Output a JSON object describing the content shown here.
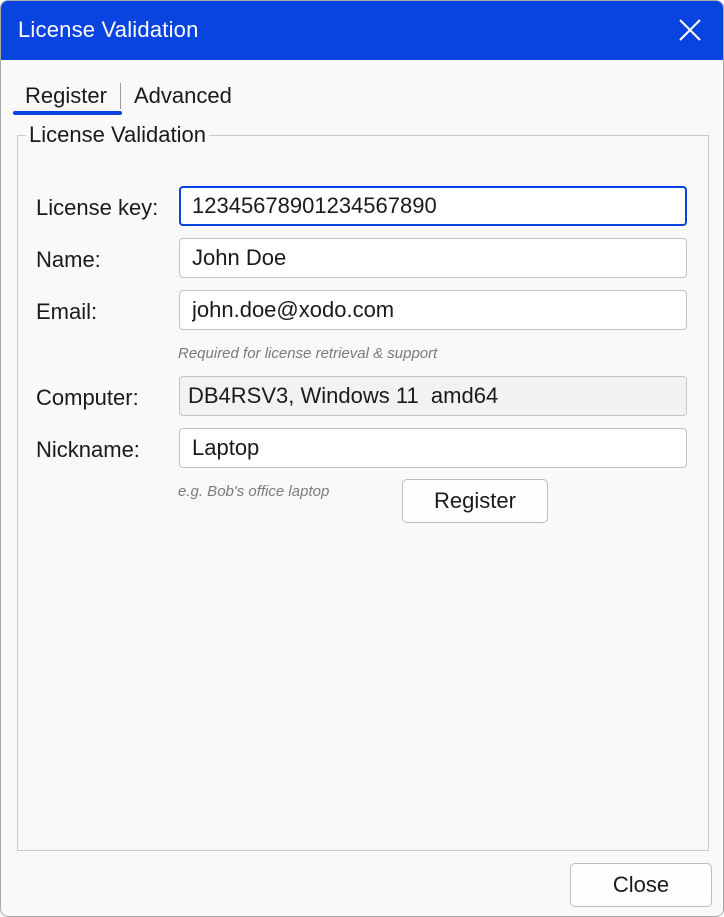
{
  "window": {
    "title": "License Validation"
  },
  "tabs": [
    {
      "label": "Register",
      "selected": true
    },
    {
      "label": "Advanced",
      "selected": false
    }
  ],
  "group": {
    "title": "License Validation"
  },
  "form": {
    "license_key": {
      "label": "License key:",
      "value": "12345678901234567890"
    },
    "name": {
      "label": "Name:",
      "value": "John Doe"
    },
    "email": {
      "label": "Email:",
      "value": "john.doe@xodo.com",
      "hint": "Required for license retrieval & support"
    },
    "computer": {
      "label": "Computer:",
      "value": "DB4RSV3, Windows 11  amd64"
    },
    "nickname": {
      "label": "Nickname:",
      "value": "Laptop",
      "hint": "e.g. Bob's office laptop"
    },
    "register_label": "Register"
  },
  "footer": {
    "close_label": "Close"
  },
  "colors": {
    "accent": "#0a44e0",
    "title_text": "#ffffff",
    "background": "#f9f9f9"
  }
}
